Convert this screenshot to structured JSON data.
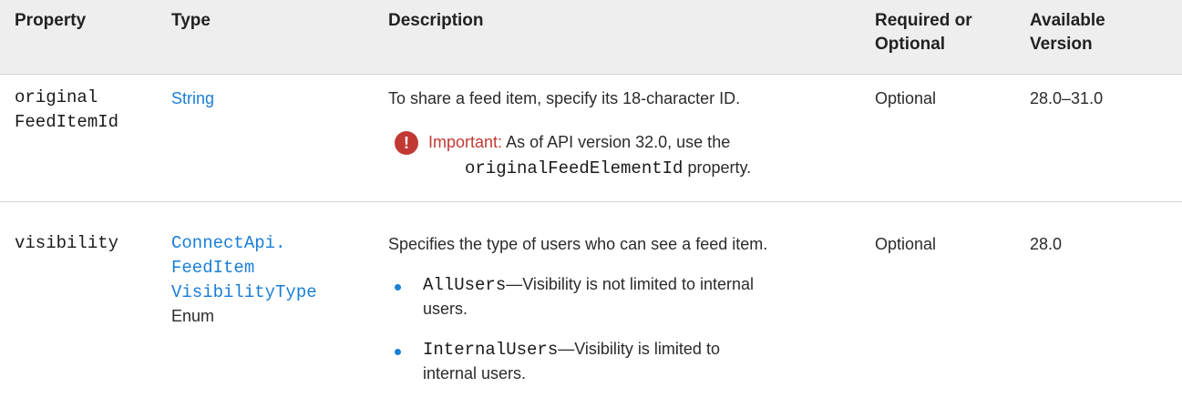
{
  "headers": {
    "property": "Property",
    "type": "Type",
    "description": "Description",
    "required_line1": "Required or",
    "required_line2": "Optional",
    "version_line1": "Available",
    "version_line2": "Version"
  },
  "rows": [
    {
      "property_line1": "original",
      "property_line2": "FeedItemId",
      "type_link": "String",
      "description": "To share a feed item, specify its 18-character ID.",
      "note_icon": "exclamation-icon",
      "note_label": "Important:",
      "note_text1": "As of API version 32.0, use the",
      "note_code": "originalFeedElementId",
      "note_text2": " property.",
      "required": "Optional",
      "version": "28.0–31.0"
    },
    {
      "property": "visibility",
      "type_link_line1": "ConnectApi.",
      "type_link_line2": "FeedItem",
      "type_link_line3": "VisibilityType",
      "type_suffix": "Enum",
      "description": "Specifies the type of users who can see a feed item.",
      "bullet1_code": "AllUsers",
      "bullet1_text_a": "—Visibility is not limited to internal",
      "bullet1_text_b": "users.",
      "bullet2_code": "InternalUsers",
      "bullet2_text_a": "—Visibility is limited to",
      "bullet2_text_b": "internal users.",
      "required": "Optional",
      "version": "28.0"
    }
  ],
  "colors": {
    "header_bg": "#eeeeee",
    "link": "#1a7ed6",
    "important": "#c23934"
  }
}
